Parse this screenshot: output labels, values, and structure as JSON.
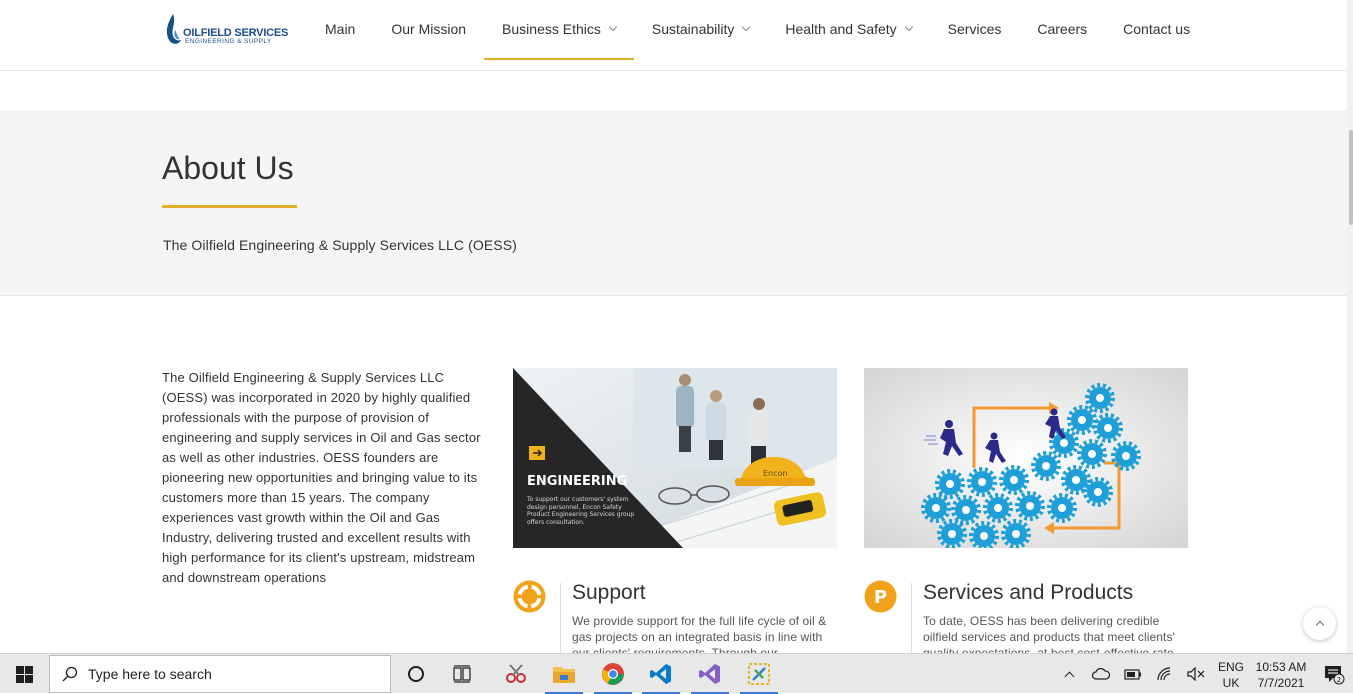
{
  "header": {
    "logo_line1": "OILFIELD SERVICES",
    "logo_line2": "ENGINEERING & SUPPLY",
    "nav": [
      {
        "label": "Main",
        "has_dropdown": false
      },
      {
        "label": "Our Mission",
        "has_dropdown": false
      },
      {
        "label": "Business Ethics",
        "has_dropdown": true,
        "active": true
      },
      {
        "label": "Sustainability",
        "has_dropdown": true
      },
      {
        "label": "Health and Safety",
        "has_dropdown": true
      },
      {
        "label": "Services",
        "has_dropdown": false
      },
      {
        "label": "Careers",
        "has_dropdown": false
      },
      {
        "label": "Contact us",
        "has_dropdown": false
      }
    ]
  },
  "about": {
    "title": "About Us",
    "subtitle": "The Oilfield Engineering & Supply Services LLC (OESS)"
  },
  "intro": {
    "text": "The Oilfield Engineering & Supply Services LLC (OESS) was incorporated in 2020 by highly qualified professionals with the purpose of provision of engineering and supply services in Oil and Gas sector as well as other industries. OESS founders are pioneering new opportunities and bringing value to its customers more than 15 years. The company experiences vast growth within the Oil and Gas Industry, delivering trusted and excellent results with high performance for its client's upstream, midstream and downstream operations"
  },
  "engineering_image": {
    "heading": "ENGINEERING",
    "caption": "To support our customers' system design personnel, Encon Safety Product Engineering Services group offers consultation.",
    "helmet_text": "Encon"
  },
  "features": {
    "support": {
      "title": "Support",
      "text": "We provide support for the full life cycle of oil & gas projects on an integrated basis in line with our clients' requirements. Through our"
    },
    "services": {
      "title": "Services and Products",
      "text": "To date, OESS has been delivering credible oilfield services and products that meet clients' quality expectations, at best cost-effective rate"
    }
  },
  "taskbar": {
    "search_placeholder": "Type here to search",
    "lang_line1": "ENG",
    "lang_line2": "UK",
    "time": "10:53 AM",
    "date": "7/7/2021",
    "notification_count": "2"
  },
  "colors": {
    "accent": "#e2b12a",
    "brand_blue": "#1a4f8a",
    "gear_blue": "#1e9fd8",
    "arrow_orange": "#f29a2e"
  }
}
